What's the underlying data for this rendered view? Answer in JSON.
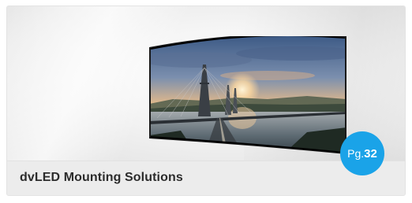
{
  "card": {
    "title": "dvLED Mounting Solutions",
    "badge_prefix": "Pg.",
    "badge_number": "32"
  },
  "image": {
    "icon": "curved-led-display-bridge-image"
  },
  "colors": {
    "badge": "#1aa3e8",
    "title": "#2c2c2c"
  }
}
